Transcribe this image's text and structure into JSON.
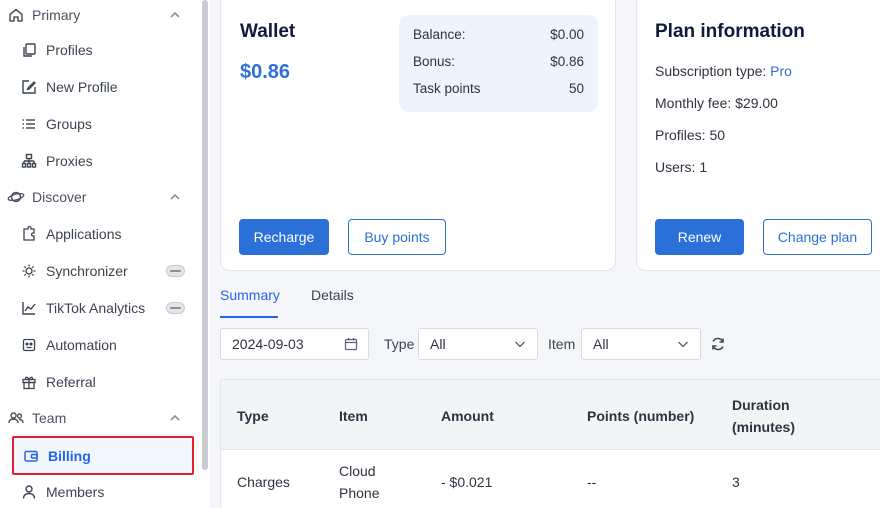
{
  "sidebar": {
    "sections": [
      {
        "label": "Primary",
        "icon": "home-icon"
      },
      {
        "label": "Discover",
        "icon": "planet-icon"
      },
      {
        "label": "Team",
        "icon": "users-icon"
      }
    ],
    "items": [
      {
        "label": "Profiles",
        "icon": "copy-icon"
      },
      {
        "label": "New Profile",
        "icon": "edit-icon"
      },
      {
        "label": "Groups",
        "icon": "list-icon"
      },
      {
        "label": "Proxies",
        "icon": "network-icon"
      },
      {
        "label": "Applications",
        "icon": "puzzle-icon"
      },
      {
        "label": "Synchronizer",
        "icon": "sync-icon"
      },
      {
        "label": "TikTok Analytics",
        "icon": "chart-line-icon"
      },
      {
        "label": "Automation",
        "icon": "robot-icon"
      },
      {
        "label": "Referral",
        "icon": "gift-icon"
      },
      {
        "label": "Billing",
        "icon": "wallet-icon"
      },
      {
        "label": "Members",
        "icon": "member-icon"
      }
    ]
  },
  "wallet": {
    "title": "Wallet",
    "amount": "$0.86",
    "balance_label": "Balance:",
    "balance_value": "$0.00",
    "bonus_label": "Bonus:",
    "bonus_value": "$0.86",
    "task_points_label": "Task points",
    "task_points_value": "50",
    "recharge_label": "Recharge",
    "buy_points_label": "Buy points"
  },
  "plan": {
    "title": "Plan information",
    "subscription_label": "Subscription type: ",
    "subscription_value": "Pro",
    "monthly_fee": "Monthly fee: $29.00",
    "profiles": "Profiles: 50",
    "users": "Users: 1",
    "renew_label": "Renew",
    "change_plan_label": "Change plan"
  },
  "tabs": [
    {
      "label": "Summary",
      "active": true
    },
    {
      "label": "Details",
      "active": false
    }
  ],
  "filters": {
    "date": "2024-09-03",
    "type_label": "Type",
    "type_value": "All",
    "item_label": "Item",
    "item_value": "All"
  },
  "table": {
    "headers": [
      "Type",
      "Item",
      "Amount",
      "Points (number)",
      "Duration\n(minutes)"
    ],
    "rows": [
      [
        "Charges",
        "Cloud\nPhone",
        "- $0.021",
        "--",
        "3"
      ]
    ]
  },
  "colors": {
    "accent": "#2b6fd8",
    "active_highlight": "#e0222a"
  }
}
